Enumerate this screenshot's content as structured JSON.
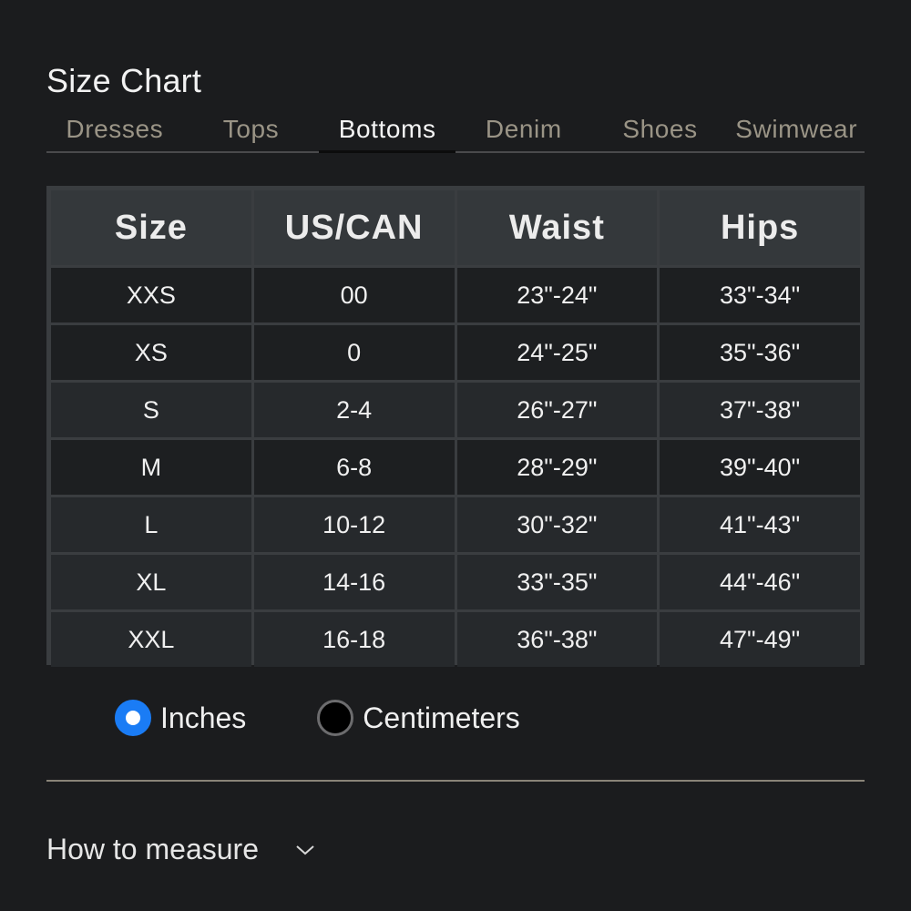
{
  "page": {
    "title": "Size Chart"
  },
  "tabs": [
    {
      "label": "Dresses",
      "active": false
    },
    {
      "label": "Tops",
      "active": false
    },
    {
      "label": "Bottoms",
      "active": true
    },
    {
      "label": "Denim",
      "active": false
    },
    {
      "label": "Shoes",
      "active": false
    },
    {
      "label": "Swimwear",
      "active": false
    }
  ],
  "table": {
    "headers": [
      "Size",
      "US/CAN",
      "Waist",
      "Hips"
    ],
    "rows": [
      [
        "XXS",
        "00",
        "23\"-24\"",
        "33\"-34\""
      ],
      [
        "XS",
        "0",
        "24\"-25\"",
        "35\"-36\""
      ],
      [
        "S",
        "2-4",
        "26\"-27\"",
        "37\"-38\""
      ],
      [
        "M",
        "6-8",
        "28\"-29\"",
        "39\"-40\""
      ],
      [
        "L",
        "10-12",
        "30\"-32\"",
        "41\"-43\""
      ],
      [
        "XL",
        "14-16",
        "33\"-35\"",
        "44\"-46\""
      ],
      [
        "XXL",
        "16-18",
        "36\"-38\"",
        "47\"-49\""
      ]
    ]
  },
  "units": {
    "options": [
      {
        "label": "Inches",
        "selected": true
      },
      {
        "label": "Centimeters",
        "selected": false
      }
    ]
  },
  "measure": {
    "label": "How to measure",
    "icon": "chevron-down-icon"
  },
  "colors": {
    "background": "#1b1c1e",
    "accent": "#1a7cf5",
    "inactive_tab": "#9a9486"
  }
}
